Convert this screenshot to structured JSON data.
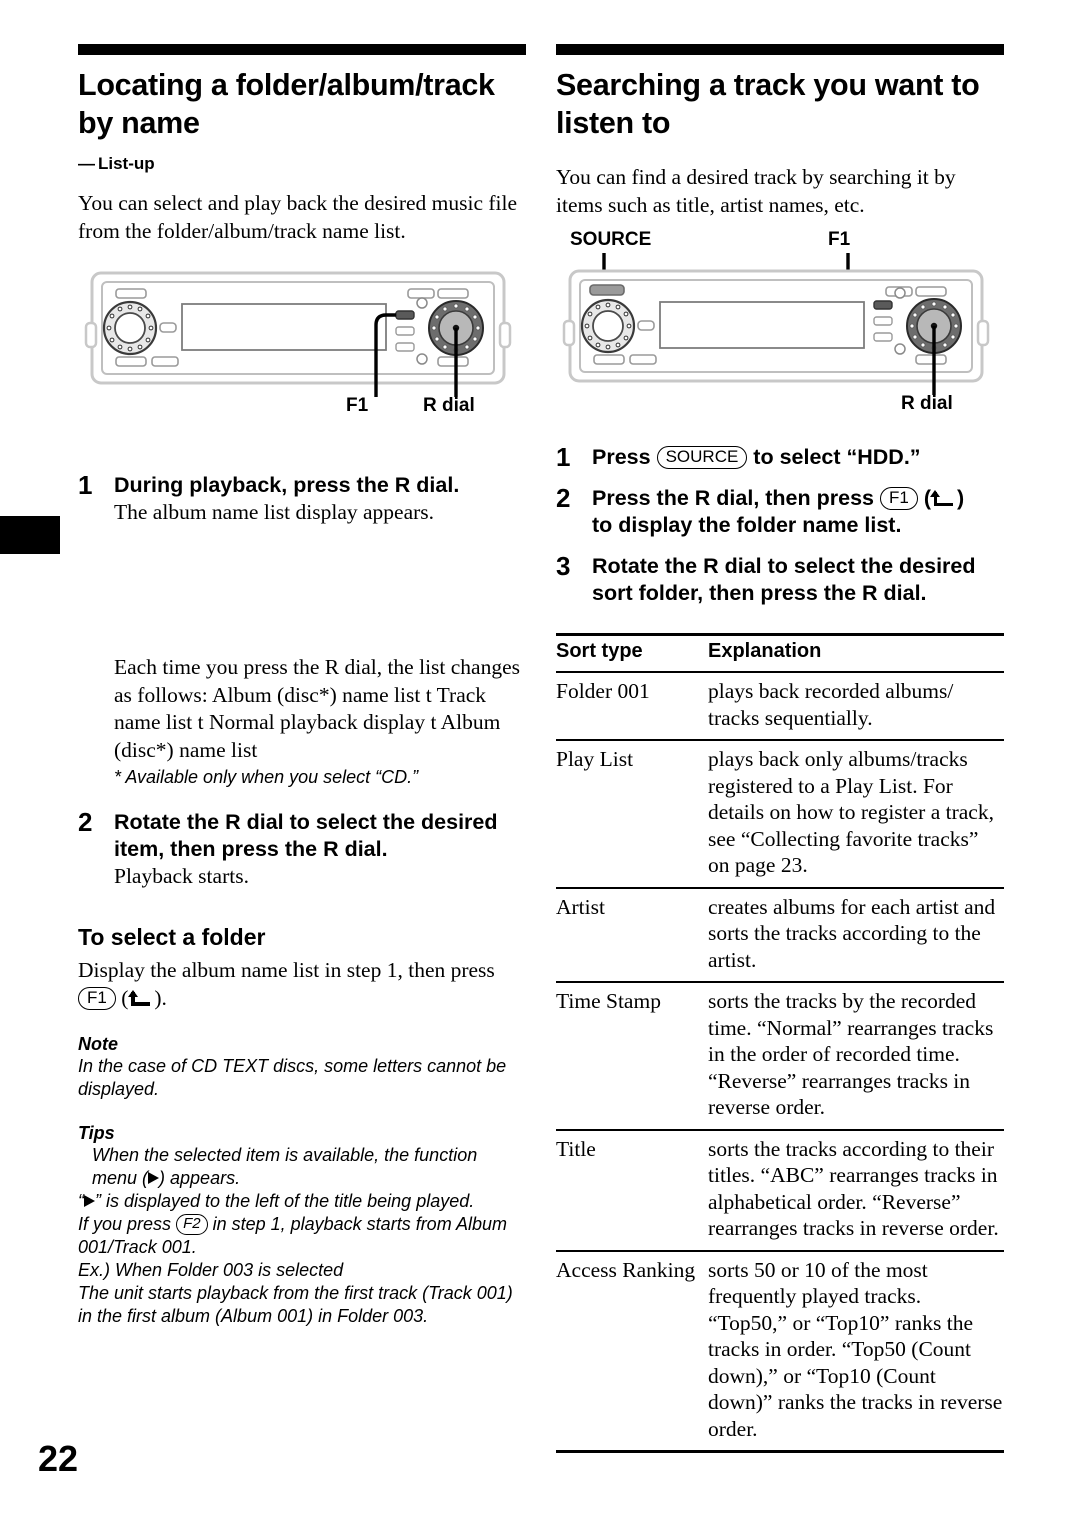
{
  "page": {
    "number": "22"
  },
  "left_column": {
    "title": "Locating a folder/album/track by name",
    "subtitle_dash": "—",
    "subtitle": "List-up",
    "intro": "You can select and play back the desired music file from the folder/album/track name list.",
    "diagram": {
      "label_f1": "F1",
      "label_r_dial": "R dial"
    },
    "step1": {
      "number": "1",
      "lead": "During playback, press the R dial.",
      "sub": "The album name list display appears."
    },
    "cycle_text": "Each time you press the R dial, the list changes as follows: Album (disc*) name list t Track name list t Normal playback display t Album (disc*) name list",
    "footnote": "* Available only when you select “CD.”",
    "step2": {
      "number": "2",
      "lead": "Rotate the R dial to select the desired item, then press the R dial.",
      "sub": "Playback starts."
    },
    "subhead_folder": "To select a folder",
    "folder_text_before": "Display the album name list in step 1, then press",
    "folder_key": "F1",
    "folder_text_after": ").",
    "note_head": "Note",
    "note_body": "In the case of CD TEXT discs, some letters cannot be displayed.",
    "tips_head": "Tips",
    "tip1_before": "When the selected item is available, the function menu (",
    "tip1_after": ") appears.",
    "tip2_open": "“",
    "tip2_after": "” is displayed to the left of the title being played.",
    "tip3_before": "If you press",
    "tip3_key": "F2",
    "tip3_after": "in step 1, playback starts from Album 001/Track 001.",
    "tip4": "Ex.) When Folder 003 is selected",
    "tip5": "The unit starts playback from the first track (Track 001) in the first album (Album 001) in Folder 003."
  },
  "right_column": {
    "title": "Searching a track you want to listen to",
    "intro": "You can find a desired track by searching it by items such as title, artist names, etc.",
    "diagram": {
      "label_source": "SOURCE",
      "label_f1": "F1",
      "label_r_dial": "R dial"
    },
    "step1": {
      "number": "1",
      "before": "Press",
      "key": "SOURCE",
      "after": "to select “HDD.”"
    },
    "step2": {
      "number": "2",
      "before": "Press the R dial, then press",
      "key": "F1",
      "after": ")",
      "line2": "to display the folder name list."
    },
    "step3": {
      "number": "3",
      "lead": "Rotate the R dial to select the desired sort folder, then press the R dial."
    },
    "table": {
      "headers": [
        "Sort type",
        "Explanation"
      ],
      "rows": [
        {
          "type": "Folder 001",
          "explanation": "plays back recorded albums/ tracks sequentially."
        },
        {
          "type": "Play List",
          "explanation": "plays back only albums/tracks registered to a Play List. For details on how to register a track, see “Collecting favorite tracks” on page 23."
        },
        {
          "type": "Artist",
          "explanation": "creates albums for each artist and sorts the tracks according to the artist."
        },
        {
          "type": "Time Stamp",
          "explanation": "sorts the tracks by the recorded time. “Normal” rearranges tracks in the order of recorded time. “Reverse” rearranges tracks in reverse order."
        },
        {
          "type": "Title",
          "explanation": "sorts the tracks according to their titles. “ABC” rearranges tracks in alphabetical order. “Reverse” rearranges tracks in reverse order."
        },
        {
          "type": "Access Ranking",
          "explanation": "sorts 50 or 10 of the most frequently played tracks. “Top50,” or “Top10” ranks the tracks in order. “Top50 (Count down),” or “Top10 (Count down)” ranks the tracks in reverse order."
        }
      ]
    }
  }
}
